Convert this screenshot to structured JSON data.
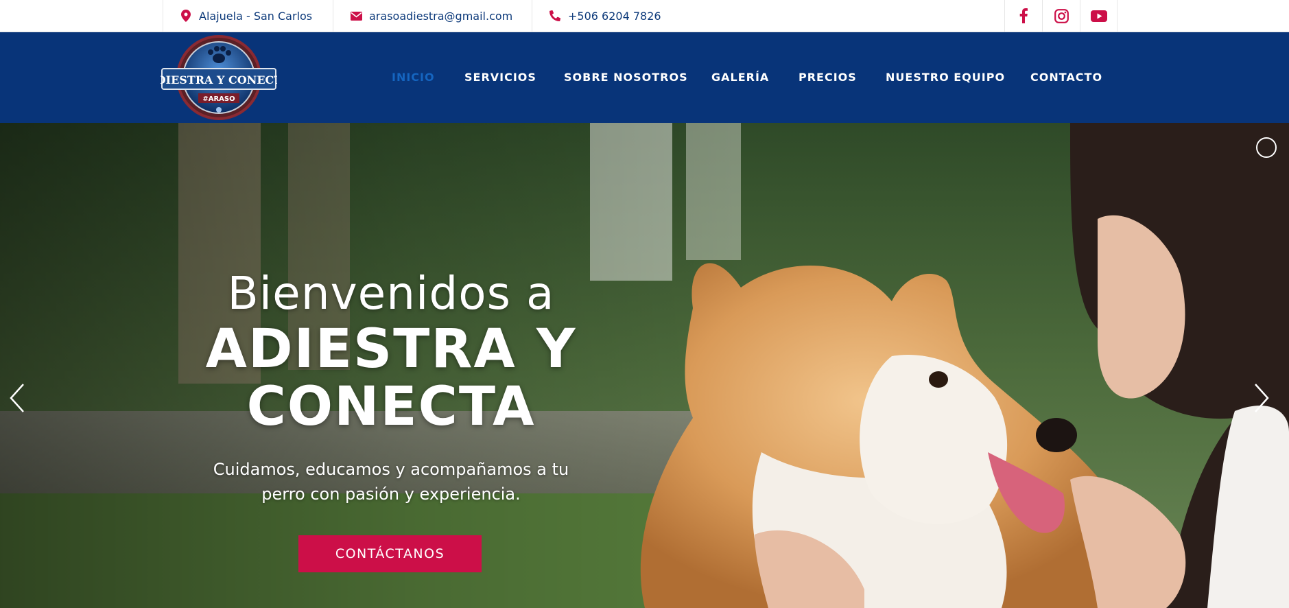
{
  "topbar": {
    "location": "Alajuela - San Carlos",
    "email": "arasoadiestra@gmail.com",
    "phone": "+506 6204 7826",
    "icons": {
      "location": "map-pin-icon",
      "email": "envelope-icon",
      "phone": "phone-icon"
    },
    "social": [
      "facebook-icon",
      "instagram-icon",
      "youtube-icon"
    ]
  },
  "nav": {
    "items": [
      "INICIO",
      "SERVICIOS",
      "SOBRE NOSOTROS",
      "GALERÍA",
      "PRECIOS",
      "NUESTRO EQUIPO",
      "CONTACTO"
    ],
    "active": "INICIO"
  },
  "logo": {
    "title": "ADIESTRA Y CONECTA",
    "tag": "#ARASO"
  },
  "hero": {
    "welcome": "Bienvenidos a",
    "brand_line1": "ADIESTRA Y",
    "brand_line2": "CONECTA",
    "subtitle_line1": "Cuidamos, educamos y acompañamos a tu",
    "subtitle_line2": "perro con pasión y experiencia.",
    "cta": "CONTÁCTANOS"
  },
  "colors": {
    "nav_bg": "#083479",
    "accent": "#cc0f48",
    "active_link": "#1565c0",
    "topbar_text": "#0d3a7a"
  }
}
